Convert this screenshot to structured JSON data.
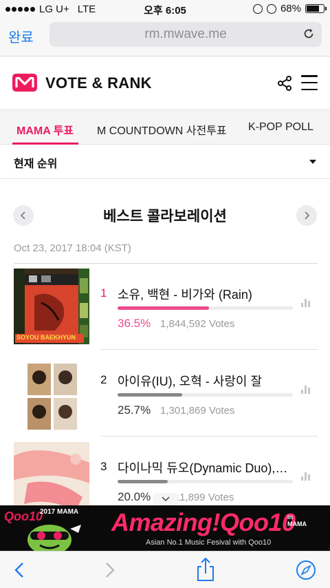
{
  "status_bar": {
    "carrier": "LG U+",
    "network": "LTE",
    "time": "오후 6:05",
    "battery": "68%"
  },
  "browser": {
    "done_label": "완료",
    "url": "rm.mwave.me"
  },
  "header": {
    "brand": "VOTE & RANK"
  },
  "tabs": [
    {
      "label": "MAMA 투표",
      "active": true
    },
    {
      "label": "M COUNTDOWN 사전투표",
      "active": false
    },
    {
      "label": "K-POP POLL",
      "active": false
    }
  ],
  "ranking_select": {
    "value": "현재 순위"
  },
  "category": {
    "title": "베스트 콜라보레이션",
    "timestamp": "Oct 23, 2017 18:04 (KST)"
  },
  "ranks": [
    {
      "rank": "1",
      "title": "소유, 백현 - 비가와 (Rain)",
      "percent": "36.5%",
      "share": 0.365,
      "votes": "1,844,592 Votes",
      "album_caption": "SOYOU BAEKHYUN"
    },
    {
      "rank": "2",
      "title": "아이유(IU), 오혁 - 사랑이 잘",
      "percent": "25.7%",
      "share": 0.257,
      "votes": "1,301,869 Votes"
    },
    {
      "rank": "3",
      "title": "다이나믹 듀오(Dynamic Duo),…",
      "percent": "20.0%",
      "share": 0.2,
      "votes": "1,011,899 Votes"
    }
  ],
  "ad": {
    "logo": "Qoo10",
    "badge": "2017 MAMA",
    "headline": "Amazing!Qoo10",
    "in_label": "in",
    "event": "MAMA",
    "sub": "Asian No.1 Music Fesival with Qoo10"
  },
  "colors": {
    "accent": "#ed1c5f",
    "bar_top": "#ed4b8c",
    "ios_blue": "#1a7cf0"
  },
  "icons": [
    "signal-dots-icon",
    "orientation-lock-icon",
    "alarm-icon",
    "battery-icon",
    "reload-icon",
    "share-icon",
    "menu-icon",
    "chevron-left-icon",
    "chevron-right-icon",
    "bar-chart-icon",
    "back-icon",
    "forward-icon",
    "share-sheet-icon",
    "compass-icon"
  ]
}
